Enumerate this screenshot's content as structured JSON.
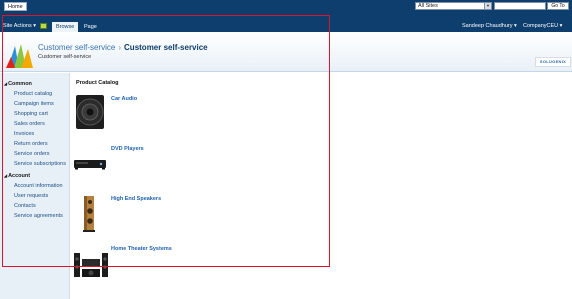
{
  "topbar": {
    "home_label": "Home",
    "scope_value": "All Sites",
    "search_value": "",
    "go_label": "Go To"
  },
  "ribbon": {
    "site_actions_label": "Site Actions ▾",
    "tabs": [
      {
        "label": "Browse",
        "selected": true
      },
      {
        "label": "Page",
        "selected": false
      }
    ],
    "user_label": "Sandeep Chaudhury ▾",
    "company_label": "CompanyCEU ▾"
  },
  "title_area": {
    "breadcrumb_parent": "Customer self-service",
    "breadcrumb_separator": "›",
    "breadcrumb_current": "Customer self-service",
    "site_description": "Customer self-service",
    "brand_label": "SOLUGENIX"
  },
  "leftnav": {
    "sections": [
      {
        "header": "Common",
        "items": [
          "Product catalog",
          "Campaign items",
          "Shopping cart",
          "Sales orders",
          "Invoices",
          "Return orders",
          "Service orders",
          "Service subscriptions"
        ]
      },
      {
        "header": "Account",
        "items": [
          "Account information",
          "User requests",
          "Contacts",
          "Service agreements"
        ]
      }
    ]
  },
  "content": {
    "title": "Product Catalog",
    "categories": [
      {
        "label": "Car Audio",
        "icon": "speaker-icon"
      },
      {
        "label": "DVD Players",
        "icon": "dvd-player-icon"
      },
      {
        "label": "High End Speakers",
        "icon": "tower-speaker-icon"
      },
      {
        "label": "Home Theater Systems",
        "icon": "home-theater-icon"
      }
    ]
  },
  "colors": {
    "topbar": "#0d3e6e",
    "link": "#1d62b0",
    "highlight": "#d9142b"
  }
}
